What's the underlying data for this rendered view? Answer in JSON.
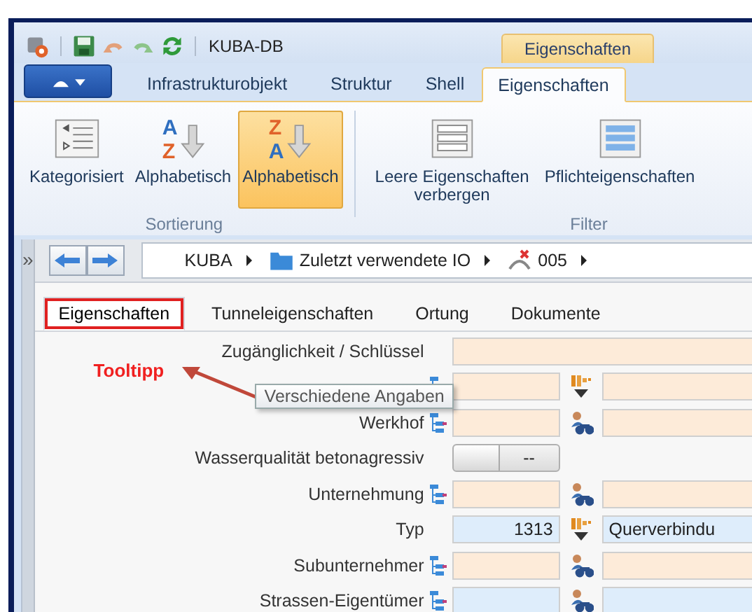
{
  "window": {
    "title": "KUBA-DB",
    "context_tab": "Eigenschaften"
  },
  "ribbon": {
    "tabs": [
      {
        "label": "Infrastrukturobjekt",
        "selected": false
      },
      {
        "label": "Struktur",
        "selected": false
      },
      {
        "label": "Shell",
        "selected": false
      },
      {
        "label": "Eigenschaften",
        "selected": true
      }
    ],
    "groups": [
      {
        "label": "Sortierung",
        "buttons": [
          {
            "label": "Kategorisiert",
            "kind": "categorized",
            "selected": false
          },
          {
            "label": "Alphabetisch",
            "kind": "az",
            "selected": false,
            "icon_top": "A",
            "icon_bottom": "Z"
          },
          {
            "label": "Alphabetisch",
            "kind": "za",
            "selected": true,
            "icon_top": "Z",
            "icon_bottom": "A"
          }
        ]
      },
      {
        "label": "Filter",
        "buttons": [
          {
            "label": "Leere Eigenschaften verbergen",
            "kind": "hide-empty",
            "selected": false
          },
          {
            "label": "Pflichteigenschaften",
            "kind": "required",
            "selected": false
          }
        ]
      }
    ]
  },
  "sidebar": {
    "toggle": "»"
  },
  "breadcrumb": [
    {
      "label": "KUBA",
      "kind": "text"
    },
    {
      "label": "Zuletzt verwendete IO",
      "kind": "folder"
    },
    {
      "label": "005",
      "kind": "object"
    }
  ],
  "form_tabs": [
    {
      "label": "Eigenschaften",
      "selected": true,
      "marked": true
    },
    {
      "label": "Tunneleigenschaften",
      "selected": false,
      "marked": false
    },
    {
      "label": "Ortung",
      "selected": false,
      "marked": false
    },
    {
      "label": "Dokumente",
      "selected": false,
      "marked": false
    }
  ],
  "annotation": {
    "text": "Tooltipp",
    "tooltip": "Verschiedene Angaben"
  },
  "rows": [
    {
      "kind": "wide",
      "label": "Zugänglichkeit / Schlüssel",
      "tree": false,
      "color": "#fdebd9"
    },
    {
      "kind": "list",
      "tree": true,
      "color": "#fdebd9"
    },
    {
      "kind": "person",
      "label": "Werkhof",
      "tree": true,
      "color": "#fdebd9"
    },
    {
      "kind": "toggle",
      "label": "Wasserqualität betonagressiv",
      "tree": false,
      "on": false,
      "value": "--"
    },
    {
      "kind": "person",
      "label": "Unternehmung",
      "tree": true,
      "color": "#fdebd9"
    },
    {
      "kind": "list",
      "label": "Typ",
      "tree": false,
      "color": "#deedfb",
      "value": "1313",
      "value2": "Querverbindu"
    },
    {
      "kind": "person",
      "label": "Subunternehmer",
      "tree": true,
      "color": "#fdebd9"
    },
    {
      "kind": "person",
      "label": "Strassen-Eigentümer",
      "tree": true,
      "color": "#deedfb"
    }
  ]
}
